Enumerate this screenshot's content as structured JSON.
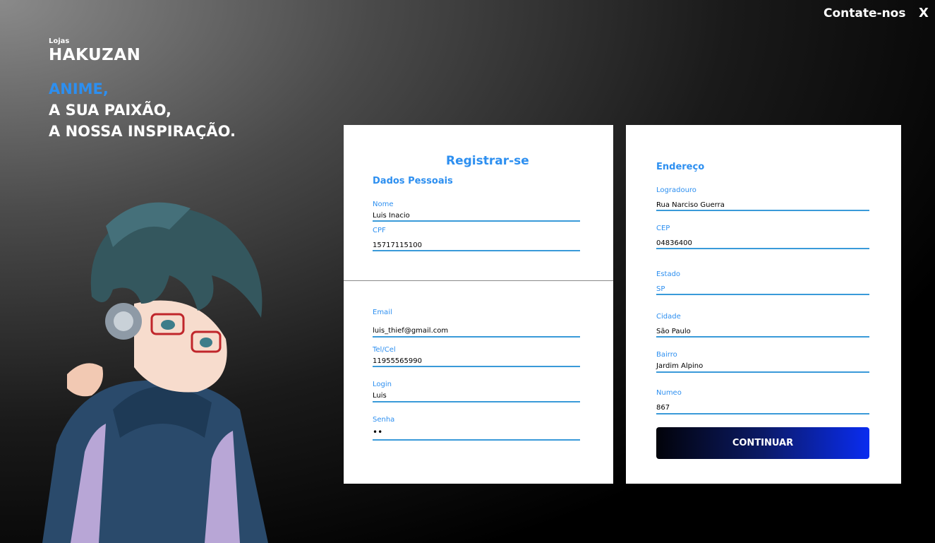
{
  "topbar": {
    "contact_label": "Contate-nos",
    "close_label": "X"
  },
  "brand": {
    "small": "Lojas",
    "name": "HAKUZAN"
  },
  "tagline": {
    "line1": "ANIME,",
    "line2": "A SUA PAIXÃO,",
    "line3": "A NOSSA INSPIRAÇÃO."
  },
  "colors": {
    "accent": "#2d8ff0",
    "field_line": "#3a9ad9",
    "button_start": "#02030a",
    "button_end": "#0a2cf0"
  },
  "register": {
    "title": "Registrar-se",
    "personal_title": "Dados Pessoais",
    "fields": {
      "nome": {
        "label": "Nome",
        "value": "Luis Inacio"
      },
      "cpf": {
        "label": "CPF",
        "value": "15717115100"
      },
      "email": {
        "label": "Email",
        "value": "luis_thief@gmail.com"
      },
      "tel": {
        "label": "Tel/Cel",
        "value": "11955565990"
      },
      "login": {
        "label": "Login",
        "value": "Luis"
      },
      "senha": {
        "label": "Senha",
        "value": "••"
      }
    }
  },
  "address": {
    "title": "Endereço",
    "fields": {
      "logradouro": {
        "label": "Logradouro",
        "value": "Rua Narciso Guerra"
      },
      "cep": {
        "label": "CEP",
        "value": "04836400"
      },
      "estado": {
        "label": "Estado",
        "value": "SP"
      },
      "cidade": {
        "label": "Cidade",
        "value": "São Paulo"
      },
      "bairro": {
        "label": "Bairro",
        "value": "Jardim Alpino"
      },
      "numero": {
        "label": "Numeo",
        "value": "867"
      }
    },
    "continue_label": "CONTINUAR"
  }
}
